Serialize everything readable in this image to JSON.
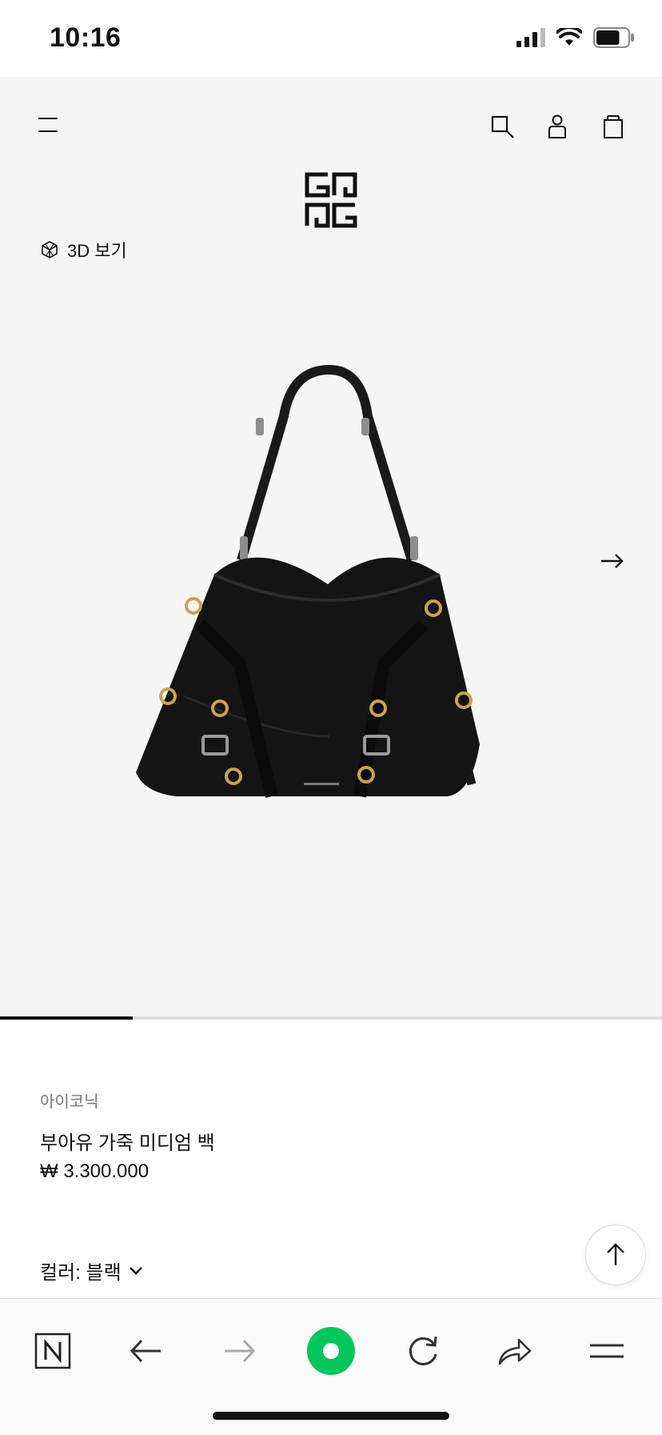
{
  "status_bar": {
    "time": "10:16",
    "battery_level": 0.75
  },
  "header": {
    "menu_icon": "menu-icon",
    "search_icon": "search-icon",
    "account_icon": "account-icon",
    "bag_icon": "shopping-bag-icon",
    "logo": "givenchy-4g-logo"
  },
  "gallery": {
    "view_3d_label": "3D 보기",
    "view_3d_icon": "cube-icon",
    "next_icon": "arrow-right-icon",
    "progress": 0.2
  },
  "product": {
    "category": "아이코닉",
    "name": "부아유 가죽 미디엄 백",
    "price": "₩ 3.300.000",
    "color_label": "컬러: 블랙",
    "scroll_top_icon": "arrow-up-icon"
  },
  "browser_toolbar": {
    "items": [
      "naver-n-icon",
      "back-icon",
      "forward-icon",
      "green-dot-icon",
      "reload-icon",
      "share-icon",
      "menu-icon"
    ],
    "accent_color": "#03c75a"
  }
}
